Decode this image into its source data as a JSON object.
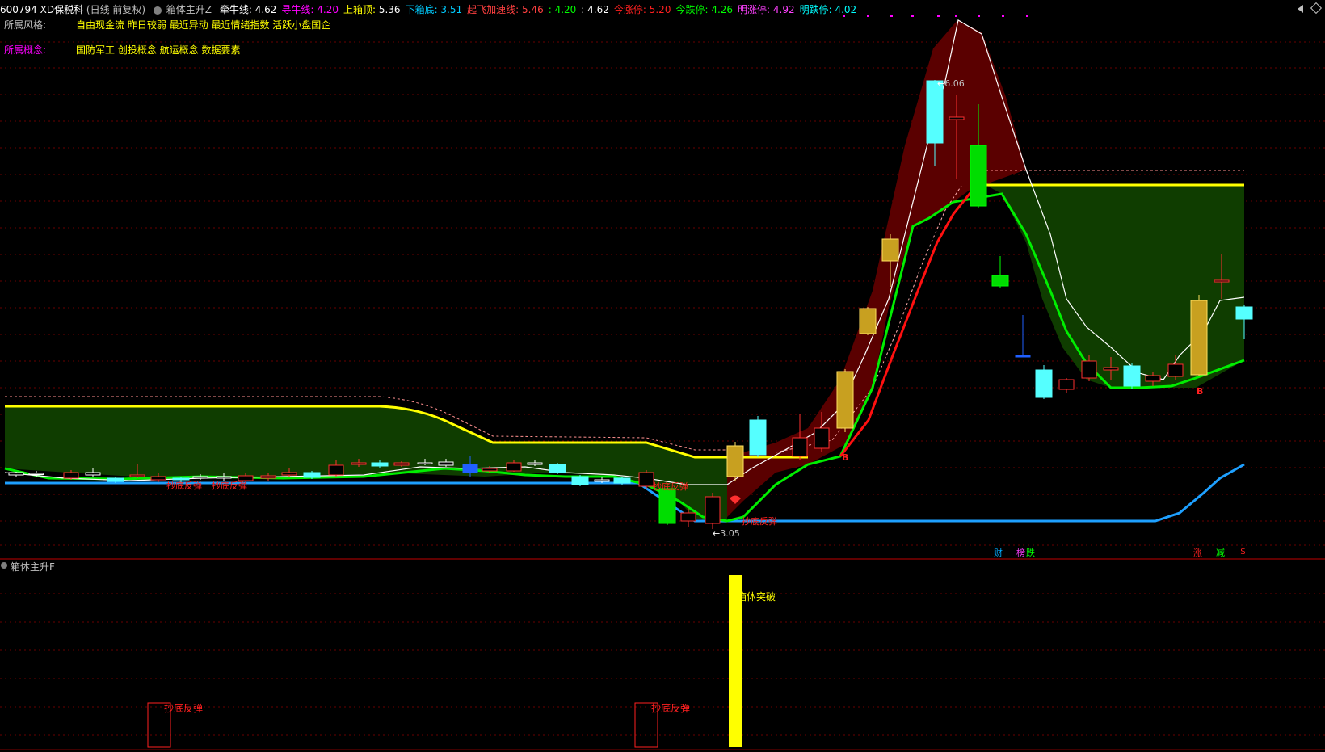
{
  "header": {
    "code_name": "600794 XD保税科",
    "period": "(日线 前复权)",
    "indicator_name": "箱体主升Z",
    "items": [
      {
        "label": "牵牛线: ",
        "value": "4.62",
        "color": "#ffffff"
      },
      {
        "label": "寻牛线: ",
        "value": "4.20",
        "color": "#ff00ff"
      },
      {
        "label": "上箱顶: ",
        "value": "5.36",
        "color": "#ffff00"
      },
      {
        "label": "下箱底: ",
        "value": "3.51",
        "color": "#00ccff"
      },
      {
        "label": "起飞加速线: ",
        "value": "5.46",
        "color": "#ff4040"
      },
      {
        "label": ": ",
        "value": "4.20",
        "color": "#00ff00"
      },
      {
        "label": ": ",
        "value": "4.62",
        "color": "#ffffff"
      },
      {
        "label": "今涨停: ",
        "value": "5.20",
        "color": "#ff2020"
      },
      {
        "label": "今跌停: ",
        "value": "4.26",
        "color": "#00ff00"
      },
      {
        "label": "明涨停: ",
        "value": "4.92",
        "color": "#ff40ff"
      },
      {
        "label": "明跌停: ",
        "value": "4.02",
        "color": "#00ffff"
      }
    ]
  },
  "tags": {
    "style_label": "所属风格:",
    "style_value": "自由现金流 昨日较弱 最近异动 最近情绪指数 活跃小盘国企",
    "concept_label": "所属概念:",
    "concept_value": "国防军工 创投概念 航运概念 数据要素"
  },
  "annotations": {
    "high_price": "6.06",
    "low_price": "3.05",
    "rebound_1": "抄底反弹",
    "rebound_2": "抄底反弹",
    "rebound_3": "抄底反弹",
    "rebound_4": "抄底反弹",
    "buy_1": "B",
    "buy_2": "B",
    "bottom_marks": [
      "财",
      "榜",
      "跌",
      "涨",
      "减",
      "$"
    ]
  },
  "sub_panel": {
    "title": "箱体主升F",
    "breakout_label": "箱体突破",
    "rebound_a": "抄底反弹",
    "rebound_b": "抄底反弹"
  },
  "colors": {
    "yellow": "#ffff00",
    "green_line": "#00ee00",
    "blue_line": "#1ea0ff",
    "red_line": "#ff1010",
    "box_fill": "#0f3d00",
    "rise_fill": "#5a0000",
    "cyan_candle": "#55ffff",
    "grid": "#800000"
  }
}
